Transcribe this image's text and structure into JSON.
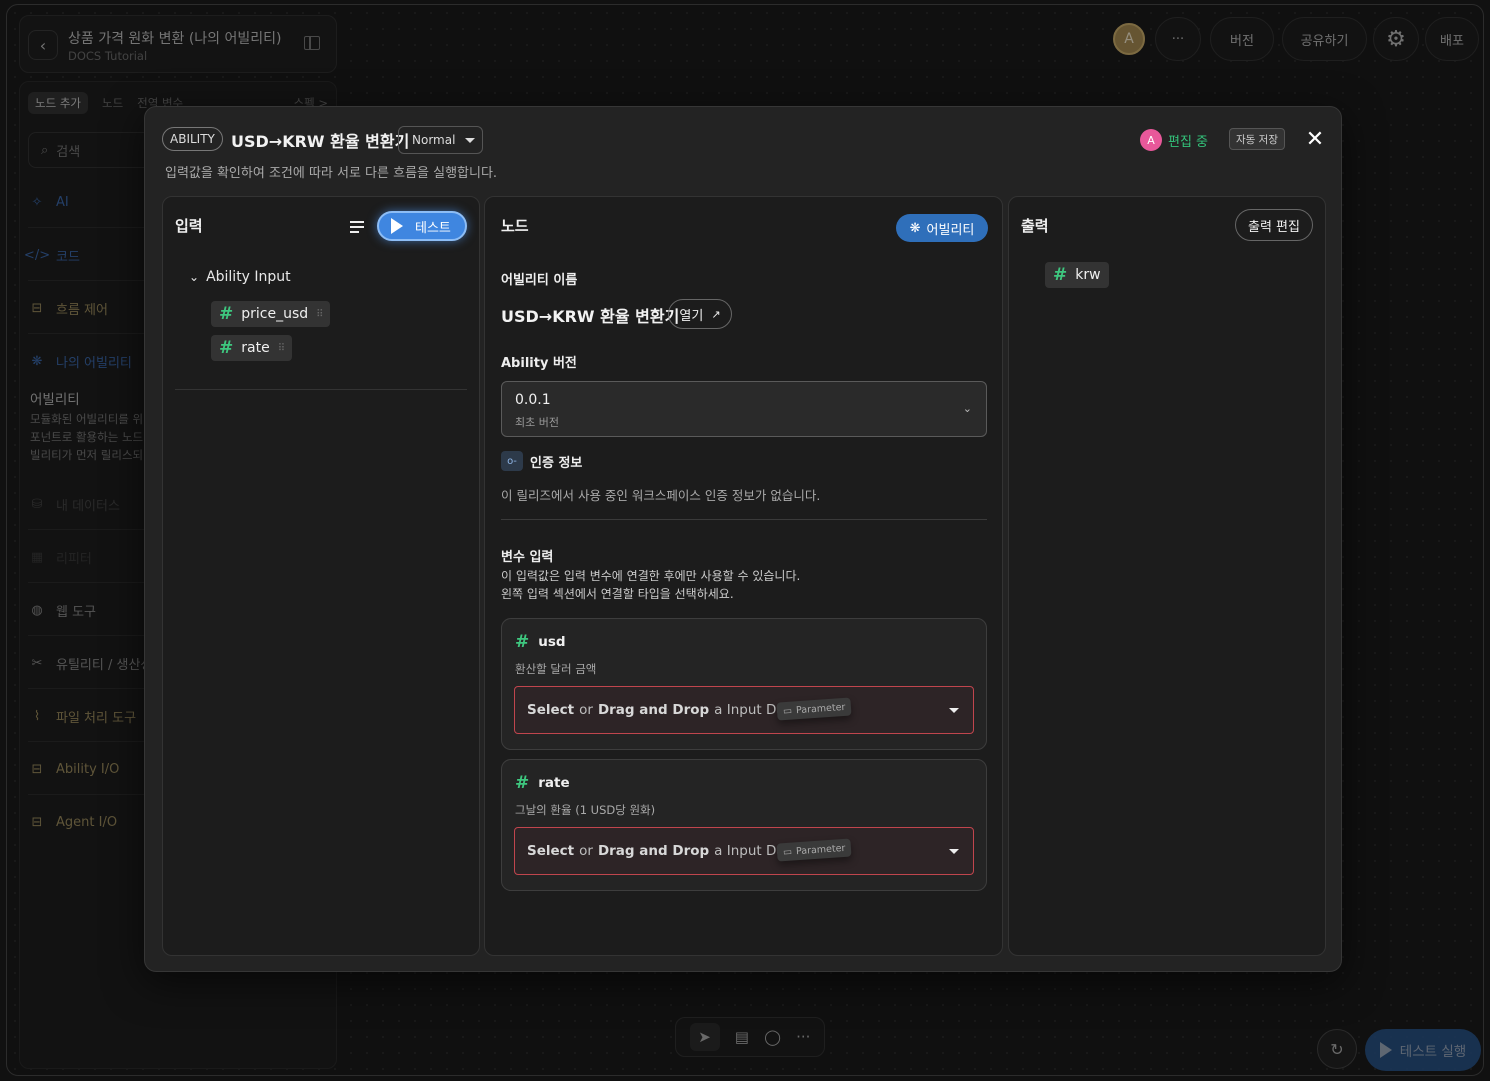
{
  "project": {
    "title": "상품 가격 원화 변환 (나의 어빌리티)",
    "subtitle": "DOCS Tutorial"
  },
  "topbar": {
    "avatar_initial": "A",
    "more_label": "···",
    "version_label": "버전",
    "share_label": "공유하기",
    "deploy_label": "배포"
  },
  "sidebar": {
    "tabs": [
      "노드 추가",
      "노드",
      "전역 변수"
    ],
    "tab_right": "스펙 >",
    "search_placeholder": "검색",
    "items": [
      {
        "label": "AI",
        "icon": "sparkle-icon"
      },
      {
        "label": "코드",
        "icon": "code-icon"
      },
      {
        "label": "흐름 제어",
        "icon": "flow-icon"
      },
      {
        "label": "나의 어빌리티",
        "icon": "ability-icon"
      },
      {
        "label": "내 데이터스",
        "icon": "database-icon"
      },
      {
        "label": "리피터",
        "icon": "table-icon"
      },
      {
        "label": "웹 도구",
        "icon": "globe-icon"
      },
      {
        "label": "유틸리티 / 생산성",
        "icon": "tools-icon"
      },
      {
        "label": "파일 처리 도구",
        "icon": "paperclip-icon"
      },
      {
        "label": "Ability I/O",
        "icon": "io-icon"
      },
      {
        "label": "Agent I/O",
        "icon": "io-icon"
      }
    ],
    "section_title": "어빌리티",
    "section_desc": [
      "모듈화된 어빌리티를 위",
      "포넌트로 활용하는 노드",
      "빌리티가 먼저 릴리스되"
    ]
  },
  "modal": {
    "badge": "ABILITY",
    "title": "USD→KRW 환율 변환기",
    "mode": "Normal",
    "description": "입력값을 확인하여 조건에 따라 서로 다른 흐름을 실행합니다.",
    "editing_avatar": "A",
    "editing_label": "편집 중",
    "autosave_label": "자동 저장",
    "input_panel": {
      "title": "입력",
      "test_label": "테스트",
      "group_label": "Ability Input",
      "fields": [
        "price_usd",
        "rate"
      ]
    },
    "node_panel": {
      "title": "노드",
      "ability_pill": "어빌리티",
      "name_label": "어빌리티 이름",
      "name_value": "USD→KRW 환율 변환기",
      "open_label": "열기",
      "version_label": "Ability 버전",
      "version_value": "0.0.1",
      "version_sub": "최초 버전",
      "auth_label": "인증 정보",
      "auth_desc": "이 릴리즈에서 사용 중인 워크스페이스 인증 정보가 없습니다.",
      "var_label": "변수 입력",
      "var_desc_1": "이 입력값은 입력 변수에 연결한 후에만 사용할 수 있습니다.",
      "var_desc_2": "왼쪽 입력 섹션에서 연결할 타입을 선택하세요.",
      "variables": [
        {
          "name": "usd",
          "desc": "환산할 달러 금액"
        },
        {
          "name": "rate",
          "desc": "그날의 환율 (1 USD당 원화)"
        }
      ],
      "field_select": "Select",
      "field_or": "or",
      "field_drag": "Drag and Drop",
      "field_rest": "a Input Data",
      "param_tag": "Parameter"
    },
    "output_panel": {
      "title": "출력",
      "edit_label": "출력 편집",
      "fields": [
        "krw"
      ]
    }
  },
  "bottom": {
    "run_label": "테스트 실행"
  }
}
